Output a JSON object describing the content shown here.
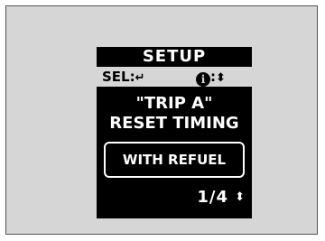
{
  "menu": {
    "title": "SETUP",
    "select_hint": {
      "label": "SEL:",
      "icon": "enter-arrow-icon",
      "glyph": "↵"
    },
    "info_hint": {
      "icon_text": "i",
      "separator": ":",
      "icon": "up-down-arrows-icon",
      "glyph": "⬍"
    },
    "heading_line1": "\"TRIP A\"",
    "heading_line2": "RESET TIMING",
    "option": "WITH REFUEL",
    "page": "1/4",
    "scroll_glyph": "⬍"
  }
}
